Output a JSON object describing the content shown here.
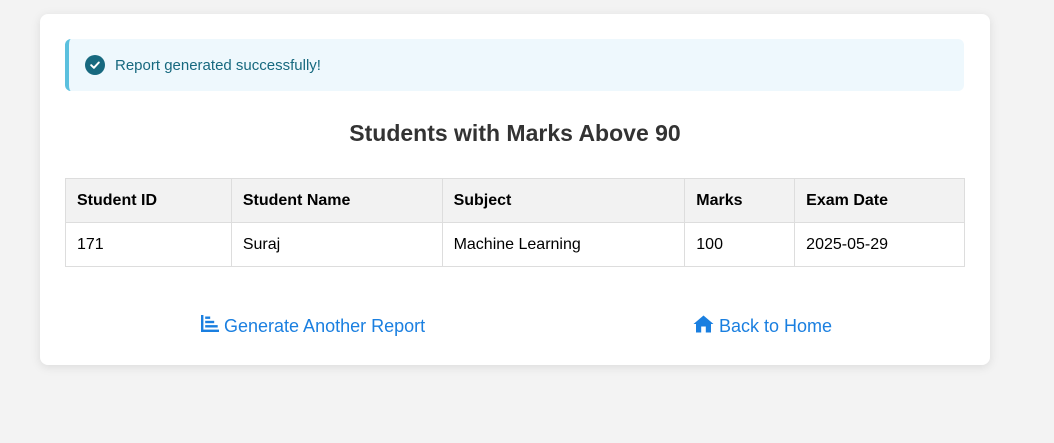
{
  "alert": {
    "icon": "check-circle-icon",
    "message": "Report generated successfully!",
    "color": "#17697f"
  },
  "report": {
    "title": "Students with Marks Above 90",
    "columns": [
      "Student ID",
      "Student Name",
      "Subject",
      "Marks",
      "Exam Date"
    ],
    "rows": [
      [
        "171",
        "Suraj",
        "Machine Learning",
        "100",
        "2025-05-29"
      ]
    ]
  },
  "actions": {
    "generate_label": "Generate Another Report",
    "generate_icon": "bar-chart-icon",
    "home_label": "Back to Home",
    "home_icon": "home-icon",
    "link_color": "#1a7fe0"
  }
}
